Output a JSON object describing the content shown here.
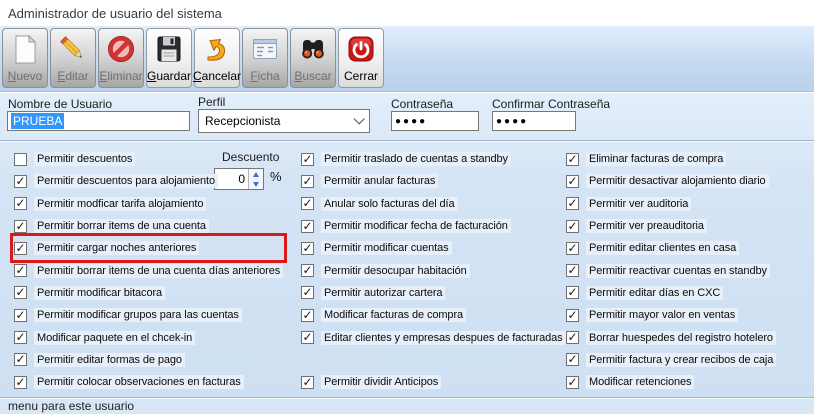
{
  "window": {
    "title": "Administrador de usuario del sistema"
  },
  "toolbar": {
    "buttons": [
      {
        "label": "Nuevo",
        "underline": 0,
        "icon": "new-document-icon",
        "enabled": false
      },
      {
        "label": "Editar",
        "underline": 0,
        "icon": "pencil-icon",
        "enabled": false
      },
      {
        "label": "Eliminar",
        "underline": 0,
        "icon": "no-entry-icon",
        "enabled": false
      },
      {
        "label": "Guardar",
        "underline": 0,
        "icon": "floppy-disk-icon",
        "enabled": true
      },
      {
        "label": "Cancelar",
        "underline": 0,
        "icon": "undo-arrow-icon",
        "enabled": true
      },
      {
        "label": "Ficha",
        "underline": 0,
        "icon": "form-icon",
        "enabled": false
      },
      {
        "label": "Buscar",
        "underline": 0,
        "icon": "binoculars-icon",
        "enabled": false
      },
      {
        "label": "Cerrar",
        "underline": -1,
        "icon": "power-icon",
        "enabled": true
      }
    ]
  },
  "form": {
    "username": {
      "label": "Nombre de Usuario",
      "value": "PRUEBA"
    },
    "profile": {
      "label": "Perfil",
      "value": "Recepcionista"
    },
    "password": {
      "label": "Contraseña",
      "value": "●●●●"
    },
    "confirm_password": {
      "label": "Confirmar Contraseña",
      "value": "●●●●"
    },
    "discount": {
      "label": "Descuento",
      "value": "0",
      "unit": "%"
    }
  },
  "permissions": {
    "columns": [
      {
        "items": [
          {
            "label": "Permitir descuentos",
            "checked": false
          },
          {
            "label": "Permitir descuentos para alojamiento",
            "checked": true
          },
          {
            "label": "Permitir modficar tarifa alojamiento",
            "checked": true
          },
          {
            "label": "Permitir borrar items de una cuenta",
            "checked": true
          },
          {
            "label": "Permitir cargar noches anteriores",
            "checked": true,
            "highlighted": true
          },
          {
            "label": "Permitir borrar items de una cuenta días anteriores",
            "checked": true
          },
          {
            "label": "Permitir modificar bitacora",
            "checked": true
          },
          {
            "label": "Permitir modificar grupos para las cuentas",
            "checked": true
          },
          {
            "label": "Modificar paquete en el chcek-in",
            "checked": true
          },
          {
            "label": "Permitir editar formas de pago",
            "checked": true
          },
          {
            "label": "Permitir colocar observaciones en facturas",
            "checked": true
          }
        ]
      },
      {
        "items": [
          {
            "label": "Permitir traslado de cuentas a standby",
            "checked": true
          },
          {
            "label": "Permitir anular facturas",
            "checked": true
          },
          {
            "label": "Anular solo facturas del día",
            "checked": true
          },
          {
            "label": "Permitir modificar fecha de facturación",
            "checked": true
          },
          {
            "label": "Permitir modificar cuentas",
            "checked": true
          },
          {
            "label": "Permitir desocupar habitación",
            "checked": true
          },
          {
            "label": "Permitir autorizar cartera",
            "checked": true
          },
          {
            "label": "Modificar facturas de compra",
            "checked": true
          },
          {
            "label": "Editar clientes y empresas despues de facturadas",
            "checked": true
          },
          {
            "empty": true
          },
          {
            "label": "Permitir dividir Anticipos",
            "checked": true
          }
        ]
      },
      {
        "items": [
          {
            "label": "Eliminar facturas de compra",
            "checked": true
          },
          {
            "label": "Permitir desactivar alojamiento diario",
            "checked": true
          },
          {
            "label": "Permitir ver auditoria",
            "checked": true
          },
          {
            "label": "Permitir ver preauditoria",
            "checked": true
          },
          {
            "label": "Permitir editar clientes en casa",
            "checked": true
          },
          {
            "label": "Permitir reactivar cuentas en standby",
            "checked": true
          },
          {
            "label": "Permitir editar días en CXC",
            "checked": true
          },
          {
            "label": "Permitir mayor valor en ventas",
            "checked": true
          },
          {
            "label": "Borrar huespedes del registro hotelero",
            "checked": true
          },
          {
            "label": "Permitir factura y crear recibos de caja",
            "checked": true
          },
          {
            "label": "Modificar retenciones",
            "checked": true
          }
        ]
      }
    ]
  },
  "statusbar": {
    "text": "menu para este usuario"
  }
}
